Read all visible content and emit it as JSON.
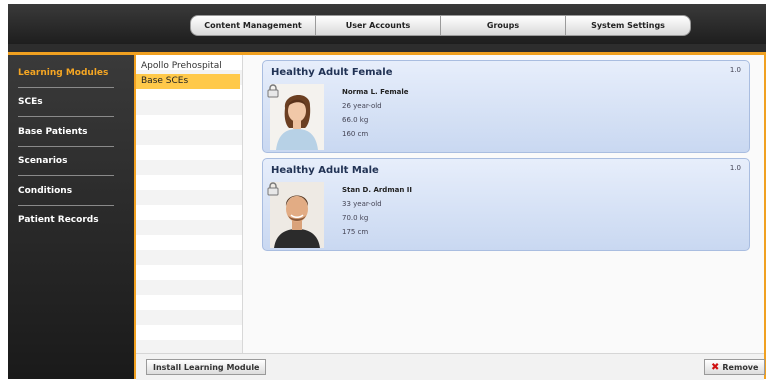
{
  "nav": {
    "tabs": [
      {
        "label": "Content Management"
      },
      {
        "label": "User Accounts"
      },
      {
        "label": "Groups"
      },
      {
        "label": "System Settings"
      }
    ]
  },
  "sidebar": {
    "items": [
      {
        "label": "Learning Modules",
        "active": true
      },
      {
        "label": "SCEs"
      },
      {
        "label": "Base Patients"
      },
      {
        "label": "Scenarios"
      },
      {
        "label": "Conditions"
      },
      {
        "label": "Patient Records"
      }
    ]
  },
  "modules": {
    "items": [
      {
        "label": "Apollo Prehospital"
      },
      {
        "label": "Base SCEs",
        "selected": true
      }
    ]
  },
  "patients": [
    {
      "title": "Healthy Adult Female",
      "version": "1.0",
      "name": "Norma L. Female",
      "age": "26 year-old",
      "weight": "66.0 kg",
      "height": "160 cm",
      "icon": "lock-icon"
    },
    {
      "title": "Healthy Adult Male",
      "version": "1.0",
      "name": "Stan D. Ardman II",
      "age": "33 year-old",
      "weight": "70.0 kg",
      "height": "175 cm",
      "icon": "lock-icon"
    }
  ],
  "footer": {
    "install_label": "Install Learning Module",
    "remove_label": "Remove"
  },
  "colors": {
    "accent": "#f0a020",
    "active_sidebar": "#f5a623",
    "selected_module": "#ffc94a",
    "card_bg": "#d3e0f4",
    "remove_icon": "#d01010"
  }
}
